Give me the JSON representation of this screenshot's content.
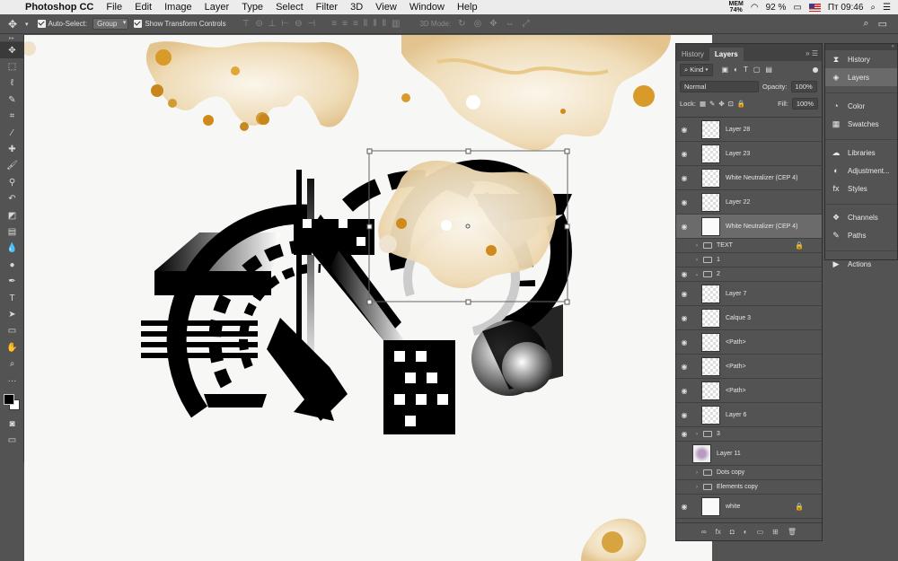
{
  "menubar": {
    "app": "Photoshop CC",
    "items": [
      "File",
      "Edit",
      "Image",
      "Layer",
      "Type",
      "Select",
      "Filter",
      "3D",
      "View",
      "Window",
      "Help"
    ],
    "mem_label": "MEM",
    "mem_value": "74%",
    "battery": "92 %",
    "clock": "Пт 09:46"
  },
  "options_bar": {
    "auto_select_label": "Auto-Select:",
    "auto_select_value": "Group",
    "show_transform_label": "Show Transform Controls",
    "mode_3d_label": "3D Mode:"
  },
  "layers_panel": {
    "tabs": [
      "History",
      "Layers"
    ],
    "active_tab": "Layers",
    "kind_filter": "Kind",
    "blend_mode": "Normal",
    "opacity_label": "Opacity:",
    "opacity_value": "100%",
    "lock_label": "Lock:",
    "fill_label": "Fill:",
    "fill_value": "100%",
    "layers": [
      {
        "name": "Layer 28",
        "visible": true,
        "type": "layer"
      },
      {
        "name": "Layer 23",
        "visible": true,
        "type": "layer"
      },
      {
        "name": "White Neutralizer (CEP 4)",
        "visible": true,
        "type": "layer"
      },
      {
        "name": "Layer 22",
        "visible": true,
        "type": "layer"
      },
      {
        "name": "White Neutralizer (CEP 4)",
        "visible": true,
        "type": "layer",
        "selected": true
      },
      {
        "name": "TEXT",
        "visible": false,
        "type": "group",
        "locked": true
      },
      {
        "name": "1",
        "visible": false,
        "type": "group"
      },
      {
        "name": "2",
        "visible": true,
        "type": "group",
        "expanded": true
      },
      {
        "name": "Layer 7",
        "visible": true,
        "type": "layer"
      },
      {
        "name": "Calque 3",
        "visible": true,
        "type": "layer"
      },
      {
        "name": "<Path>",
        "visible": true,
        "type": "layer"
      },
      {
        "name": "<Path>",
        "visible": true,
        "type": "layer"
      },
      {
        "name": "<Path>",
        "visible": true,
        "type": "layer"
      },
      {
        "name": "Layer 6",
        "visible": true,
        "type": "layer"
      },
      {
        "name": "3",
        "visible": true,
        "type": "group"
      },
      {
        "name": "Layer 11",
        "visible": false,
        "type": "layer"
      },
      {
        "name": "Dots copy",
        "visible": false,
        "type": "group"
      },
      {
        "name": "Elements copy",
        "visible": false,
        "type": "group"
      },
      {
        "name": "white",
        "visible": true,
        "type": "layer",
        "locked": true
      }
    ]
  },
  "side_panels": {
    "group1": [
      "History",
      "Layers"
    ],
    "group2": [
      "Color",
      "Swatches"
    ],
    "group3": [
      "Libraries",
      "Adjustment...",
      "Styles"
    ],
    "group4": [
      "Channels",
      "Paths"
    ],
    "group5": [
      "Actions"
    ]
  }
}
